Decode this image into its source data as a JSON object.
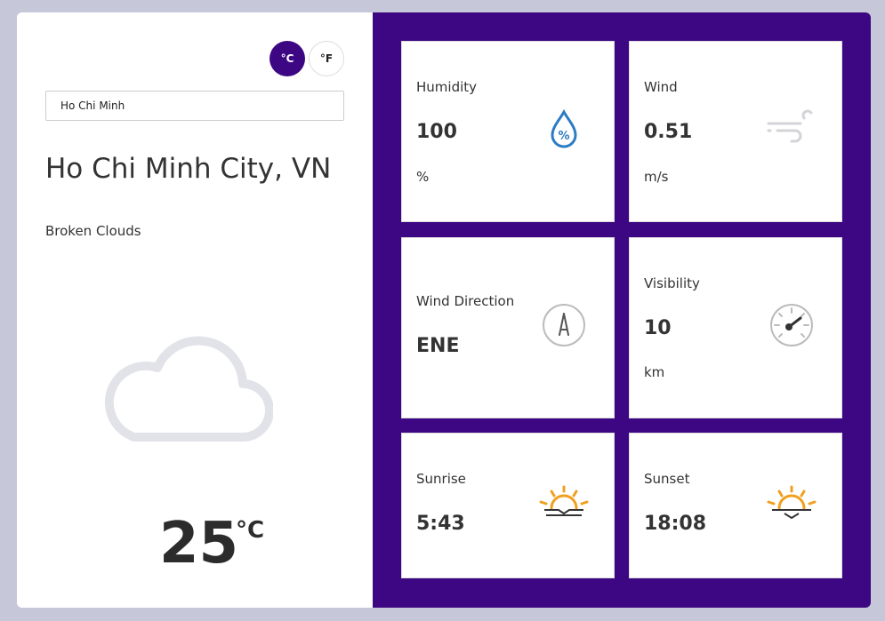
{
  "units": {
    "celsius": "°C",
    "fahrenheit": "°F"
  },
  "search": {
    "value": "Ho Chi Minh"
  },
  "location": "Ho Chi Minh City, VN",
  "description": "Broken Clouds",
  "temperature": {
    "value": "25",
    "unit": "°C"
  },
  "colors": {
    "accent": "#3d0783",
    "humidity_icon": "#2c7bc4",
    "sun_icon": "#f0a020",
    "muted_icon": "#bbbbbb"
  },
  "cards": {
    "humidity": {
      "label": "Humidity",
      "value": "100",
      "unit": "%",
      "icon": "humidity-icon"
    },
    "wind": {
      "label": "Wind",
      "value": "0.51",
      "unit": "m/s",
      "icon": "wind-icon"
    },
    "wind_direction": {
      "label": "Wind Direction",
      "value": "ENE",
      "icon": "compass-icon"
    },
    "visibility": {
      "label": "Visibility",
      "value": "10",
      "unit": "km",
      "icon": "gauge-icon"
    },
    "sunrise": {
      "label": "Sunrise",
      "value": "5:43",
      "icon": "sunrise-icon"
    },
    "sunset": {
      "label": "Sunset",
      "value": "18:08",
      "icon": "sunset-icon"
    }
  }
}
